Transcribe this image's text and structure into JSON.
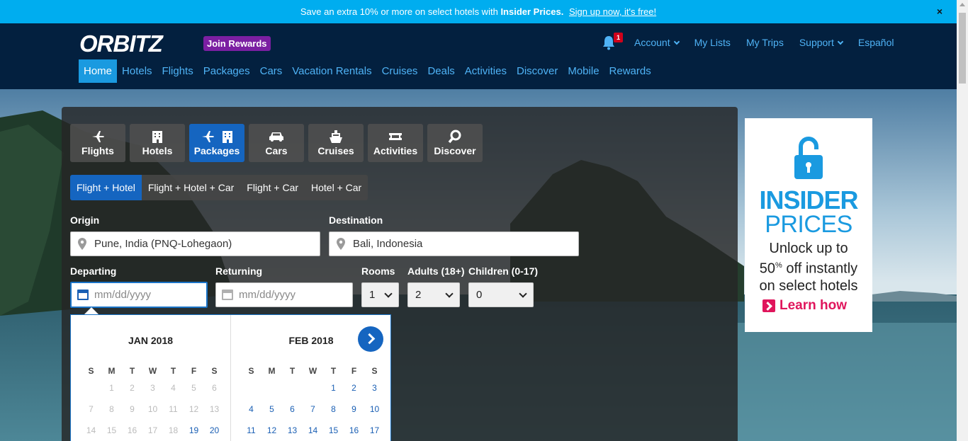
{
  "promo": {
    "text": "Save an extra 10% or more on select hotels with",
    "bold": "Insider Prices.",
    "link": "Sign up now, it's free!",
    "close": "×"
  },
  "header": {
    "logo": "ORBITZ",
    "join_rewards": "Join Rewards",
    "notification_count": "1",
    "toplinks": [
      "Account",
      "My Lists",
      "My Trips",
      "Support",
      "Español"
    ],
    "nav": [
      "Home",
      "Hotels",
      "Flights",
      "Packages",
      "Cars",
      "Vacation Rentals",
      "Cruises",
      "Deals",
      "Activities",
      "Discover",
      "Mobile",
      "Rewards"
    ]
  },
  "search": {
    "tabs": [
      "Flights",
      "Hotels",
      "Packages",
      "Cars",
      "Cruises",
      "Activities",
      "Discover"
    ],
    "active_tab": "Packages",
    "subtabs": [
      "Flight + Hotel",
      "Flight + Hotel + Car",
      "Flight + Car",
      "Hotel + Car"
    ],
    "origin_label": "Origin",
    "origin_value": "Pune, India (PNQ-Lohegaon)",
    "destination_label": "Destination",
    "destination_value": "Bali, Indonesia",
    "departing_label": "Departing",
    "departing_placeholder": "mm/dd/yyyy",
    "returning_label": "Returning",
    "returning_placeholder": "mm/dd/yyyy",
    "rooms_label": "Rooms",
    "rooms_value": "1",
    "adults_label": "Adults (18+)",
    "adults_value": "2",
    "children_label": "Children (0-17)",
    "children_value": "0"
  },
  "calendar": {
    "dow": [
      "S",
      "M",
      "T",
      "W",
      "T",
      "F",
      "S"
    ],
    "month1": {
      "title": "JAN 2018",
      "weeks": [
        [
          "",
          "1",
          "2",
          "3",
          "4",
          "5",
          "6"
        ],
        [
          "7",
          "8",
          "9",
          "10",
          "11",
          "12",
          "13"
        ],
        [
          "14",
          "15",
          "16",
          "17",
          "18",
          "19",
          "20"
        ]
      ],
      "first_available": 19
    },
    "month2": {
      "title": "FEB 2018",
      "weeks": [
        [
          "",
          "",
          "",
          "",
          "1",
          "2",
          "3"
        ],
        [
          "4",
          "5",
          "6",
          "7",
          "8",
          "9",
          "10"
        ],
        [
          "11",
          "12",
          "13",
          "14",
          "15",
          "16",
          "17"
        ]
      ]
    }
  },
  "ad": {
    "headline1": "INSIDER",
    "headline2": "PRICES",
    "body1": "Unlock up to",
    "body2_a": "50",
    "body2_sup": "%",
    "body2_b": " off instantly",
    "body3": "on select hotels",
    "cta": "Learn how"
  },
  "colors": {
    "promo_bg": "#00adef",
    "header_bg": "#03203f",
    "link_blue": "#4fb3f6",
    "active_blue": "#1565c0",
    "rewards_purple": "#7b1fa2",
    "ad_blue": "#1a9ae0",
    "ad_pink": "#e0155c"
  }
}
